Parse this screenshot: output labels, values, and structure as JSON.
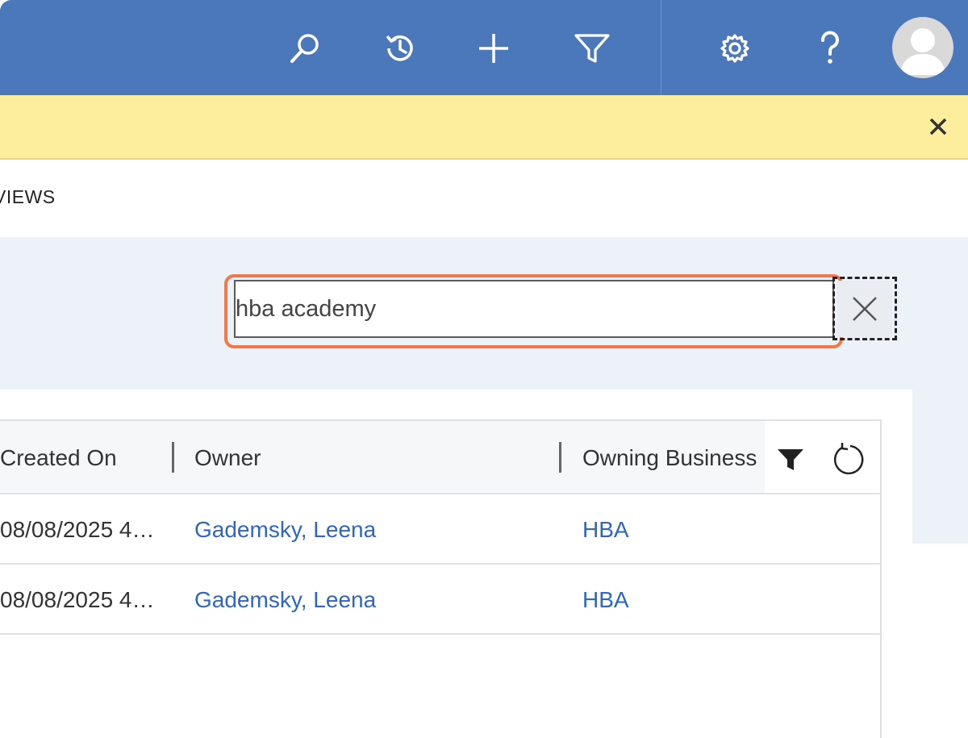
{
  "topbar": {
    "icons": [
      "search-icon",
      "recent-icon",
      "add-icon",
      "filter-icon",
      "settings-icon",
      "help-icon",
      "avatar"
    ],
    "color": "#4a78ba"
  },
  "notification": {
    "color": "#fdee9e",
    "close_icon": "close-icon"
  },
  "views": {
    "label": "VIEWS"
  },
  "search": {
    "value": "hba academy",
    "clear_icon": "clear-icon"
  },
  "grid": {
    "columns": [
      "Created On",
      "Owner",
      "Owning Business"
    ],
    "rows": [
      {
        "created_on": "08/08/2025 4…",
        "owner": "Gademsky, Leena",
        "business_unit": "HBA"
      },
      {
        "created_on": "08/08/2025 4…",
        "owner": "Gademsky, Leena",
        "business_unit": "HBA"
      }
    ],
    "header_icons": [
      "funnel-icon",
      "refresh-icon"
    ],
    "link_color": "#2d66c3"
  }
}
